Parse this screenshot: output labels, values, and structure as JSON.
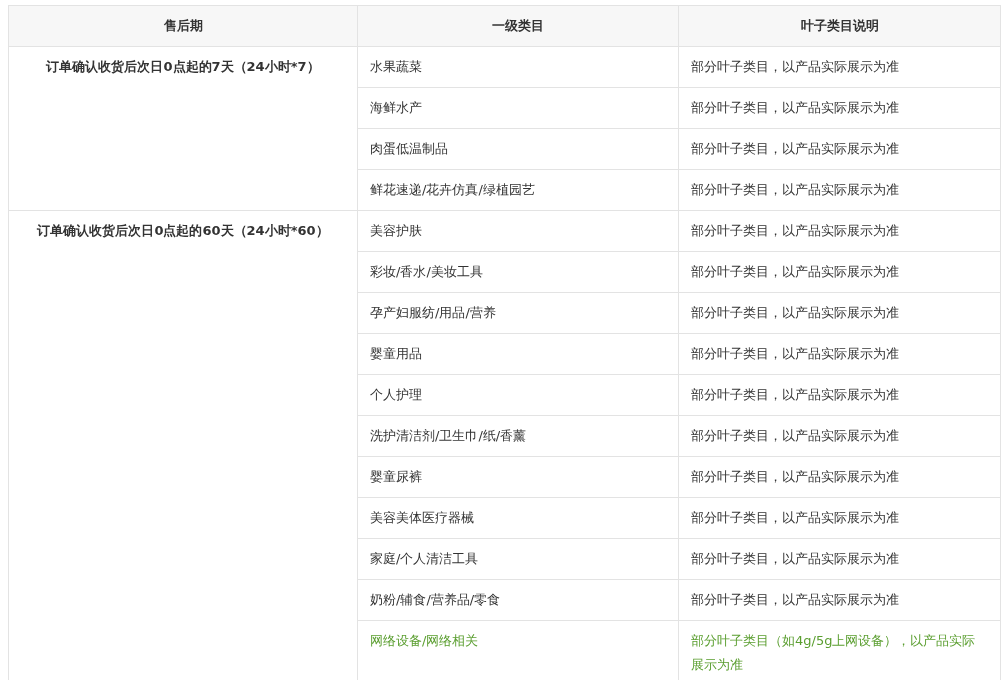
{
  "table": {
    "columns": [
      "售后期",
      "一级类目",
      "叶子类目说明"
    ],
    "groups": [
      {
        "period": "订单确认收货后次日0点起的7天（24小时*7）",
        "rows": [
          {
            "category": "水果蔬菜",
            "description": "部分叶子类目，以产品实际展示为准",
            "highlighted": false
          },
          {
            "category": "海鲜水产",
            "description": "部分叶子类目，以产品实际展示为准",
            "highlighted": false
          },
          {
            "category": "肉蛋低温制品",
            "description": "部分叶子类目，以产品实际展示为准",
            "highlighted": false
          },
          {
            "category": "鲜花速递/花卉仿真/绿植园艺",
            "description": "部分叶子类目，以产品实际展示为准",
            "highlighted": false
          }
        ]
      },
      {
        "period": "订单确认收货后次日0点起的60天（24小时*60）",
        "rows": [
          {
            "category": "美容护肤",
            "description": "部分叶子类目，以产品实际展示为准",
            "highlighted": false
          },
          {
            "category": "彩妆/香水/美妆工具",
            "description": "部分叶子类目，以产品实际展示为准",
            "highlighted": false
          },
          {
            "category": "孕产妇服纺/用品/营养",
            "description": "部分叶子类目，以产品实际展示为准",
            "highlighted": false
          },
          {
            "category": "婴童用品",
            "description": "部分叶子类目，以产品实际展示为准",
            "highlighted": false
          },
          {
            "category": "个人护理",
            "description": "部分叶子类目，以产品实际展示为准",
            "highlighted": false
          },
          {
            "category": "洗护清洁剂/卫生巾/纸/香薰",
            "description": "部分叶子类目，以产品实际展示为准",
            "highlighted": false
          },
          {
            "category": "婴童尿裤",
            "description": "部分叶子类目，以产品实际展示为准",
            "highlighted": false
          },
          {
            "category": "美容美体医疗器械",
            "description": "部分叶子类目，以产品实际展示为准",
            "highlighted": false
          },
          {
            "category": "家庭/个人清洁工具",
            "description": "部分叶子类目，以产品实际展示为准",
            "highlighted": false
          },
          {
            "category": "奶粉/辅食/营养品/零食",
            "description": "部分叶子类目，以产品实际展示为准",
            "highlighted": false
          },
          {
            "category": "网络设备/网络相关",
            "description": "部分叶子类目（如4g/5g上网设备），以产品实际展示为准",
            "highlighted": true
          }
        ]
      }
    ]
  }
}
